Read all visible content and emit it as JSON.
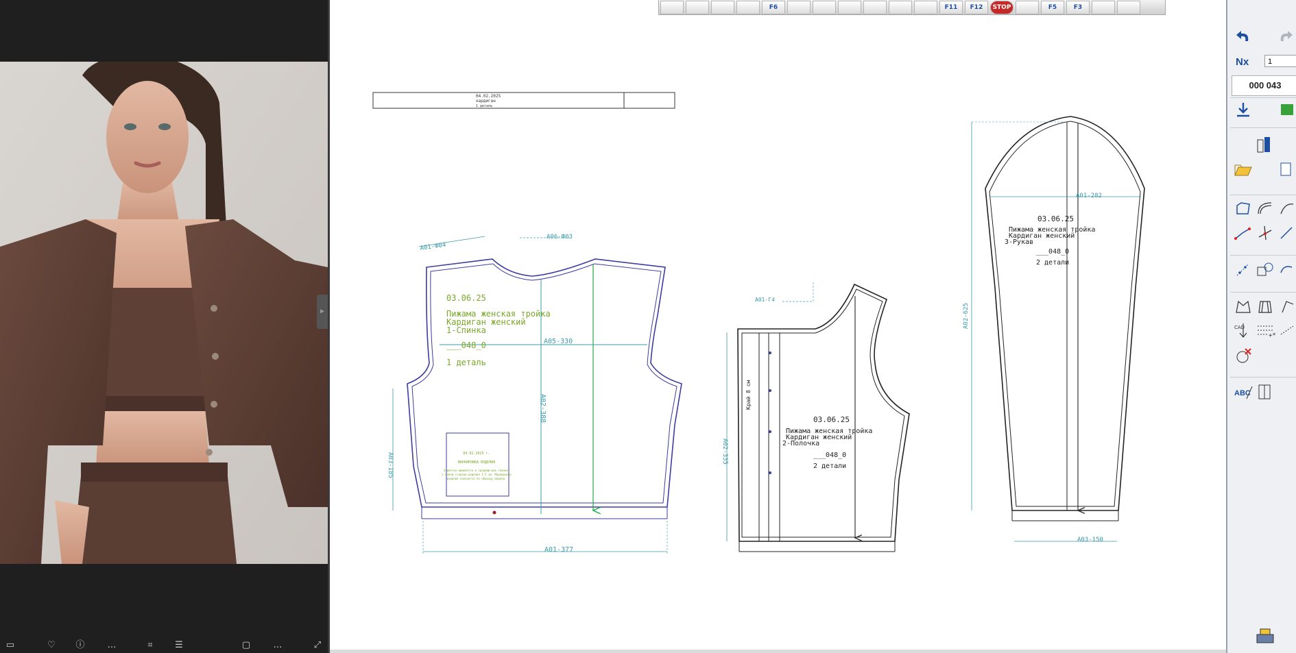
{
  "app": {
    "toolbar_buttons": [
      {
        "icon": "open-folder-icon",
        "label": ""
      },
      {
        "icon": "save-icon",
        "label": ""
      },
      {
        "icon": "print-icon",
        "label": ""
      },
      {
        "icon": "zoom-icon",
        "label": ""
      },
      {
        "icon": "f6-icon",
        "label": "F6"
      },
      {
        "icon": "copy-icon",
        "label": ""
      },
      {
        "icon": "ruler-icon",
        "label": ""
      },
      {
        "icon": "download-icon",
        "label": ""
      },
      {
        "icon": "layers-icon",
        "label": ""
      },
      {
        "icon": "grade-icon",
        "label": ""
      },
      {
        "icon": "exit-icon",
        "label": ""
      },
      {
        "icon": "f11-icon",
        "label": "F11"
      },
      {
        "icon": "f12-icon",
        "label": "F12"
      },
      {
        "icon": "stop-icon",
        "label": "STOP"
      },
      {
        "icon": "pattern-icon",
        "label": ""
      },
      {
        "icon": "f5-icon",
        "label": "F5"
      },
      {
        "icon": "f3-icon",
        "label": "F3"
      },
      {
        "icon": "trousers-icon",
        "label": ""
      },
      {
        "icon": "hand-icon",
        "label": ""
      }
    ],
    "right_panel": {
      "counter": "000 043",
      "input_value": "1"
    }
  },
  "canvas": {
    "title_block": {
      "line1": "04.02.2025",
      "line2": "кардиган",
      "line3": "1 деталь"
    },
    "back": {
      "date": "03.06.25",
      "line1": "Пижама женская тройка",
      "line2": "Кардиган женский",
      "line3": "1-Спинка",
      "code": "___048_0",
      "count": "1 деталь",
      "dim_shoulder": "А01-Ф04",
      "dim_neck": "А06-Ф03",
      "dim_width": "А05-330",
      "dim_length": "А02-388",
      "dim_side": "А03-185",
      "dim_hem": "А01-377",
      "label_box": {
        "line1": "04.02.2025 г.",
        "line2": "МАРКИРОВКА ИЗДЕЛИЯ",
        "line3": "Этикетка вшивается в среднюю шов спинки,",
        "line4": "с левой стороны изделия 1.5 см. Маркировка",
        "line5": "изделия наносится по образцу модели."
      }
    },
    "front": {
      "date": "03.06.25",
      "line1": "Пижама женская тройка",
      "line2": "Кардиган женский",
      "line3": "2-Полочка",
      "code": "___048_0",
      "count": "2 детали",
      "dim_shoulder": "А01-Г4",
      "dim_length": "А02-335",
      "fold": "Край 8 см"
    },
    "sleeve": {
      "date": "03.06.25",
      "line1": "Пижама женская тройка",
      "line2": "Кардиган женский",
      "line3": "3-Рукав",
      "code": "___048_0",
      "count": "2 детали",
      "dim_width": "А01-282",
      "dim_length": "А02-625",
      "dim_cuff": "А03-150"
    }
  },
  "colors": {
    "pattern_outline": "#3b3ba0",
    "pattern_outline_black": "#222222",
    "dimension": "#3a9aa8",
    "label_green": "#7aa82a",
    "grain_green": "#22aa44",
    "viewer_bg": "#1f1f1f"
  }
}
